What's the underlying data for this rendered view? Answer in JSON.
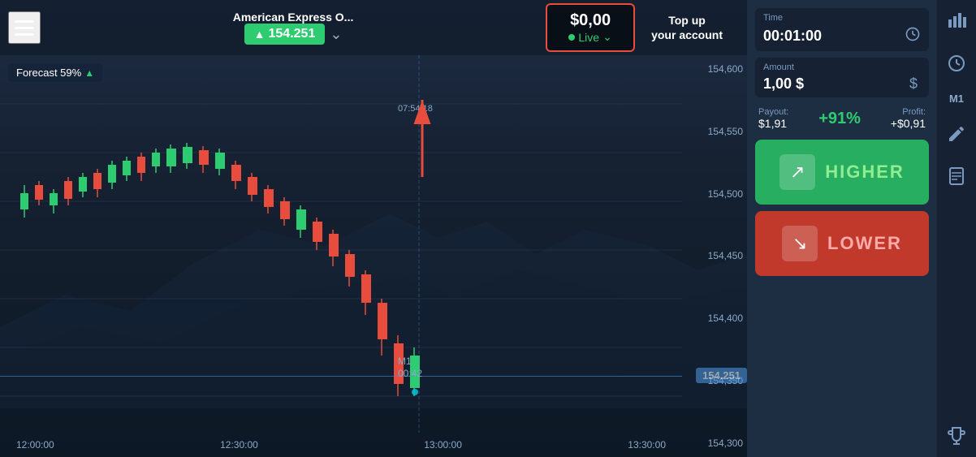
{
  "header": {
    "asset_name": "American Express O...",
    "asset_price": "154.251",
    "balance": "$0,00",
    "balance_mode": "Live",
    "topup_line1": "Top up",
    "topup_line2": "your account"
  },
  "panel": {
    "time_label": "Time",
    "time_value": "00:01:00",
    "amount_label": "Amount",
    "amount_value": "1,00 $",
    "currency_symbol": "$",
    "payout_label": "Payout:",
    "payout_value": "$1,91",
    "payout_percent": "+91%",
    "profit_label": "Profit:",
    "profit_value": "+$0,91",
    "higher_label": "HIGHER",
    "lower_label": "LOWER",
    "timeframe_label": "M1"
  },
  "chart": {
    "forecast": "Forecast 59%",
    "timestamp": "07:54:18",
    "current_price": "154.251",
    "m1_label": "M1",
    "m1_time": "00:42",
    "price_levels": [
      "154,600",
      "154,550",
      "154,500",
      "154,450",
      "154,400",
      "154,350",
      "154,300"
    ],
    "time_labels": [
      "12:00:00",
      "12:30:00",
      "13:00:00",
      "13:30:00"
    ]
  },
  "icons": {
    "hamburger": "☰",
    "chevron_down": "⌄",
    "clock": "🕐",
    "currency": "$",
    "bar_chart": "📊",
    "edit": "✏",
    "book": "📖",
    "trophy": "🏆",
    "arrow_up_diagonal": "↗",
    "arrow_down_diagonal": "↘"
  }
}
